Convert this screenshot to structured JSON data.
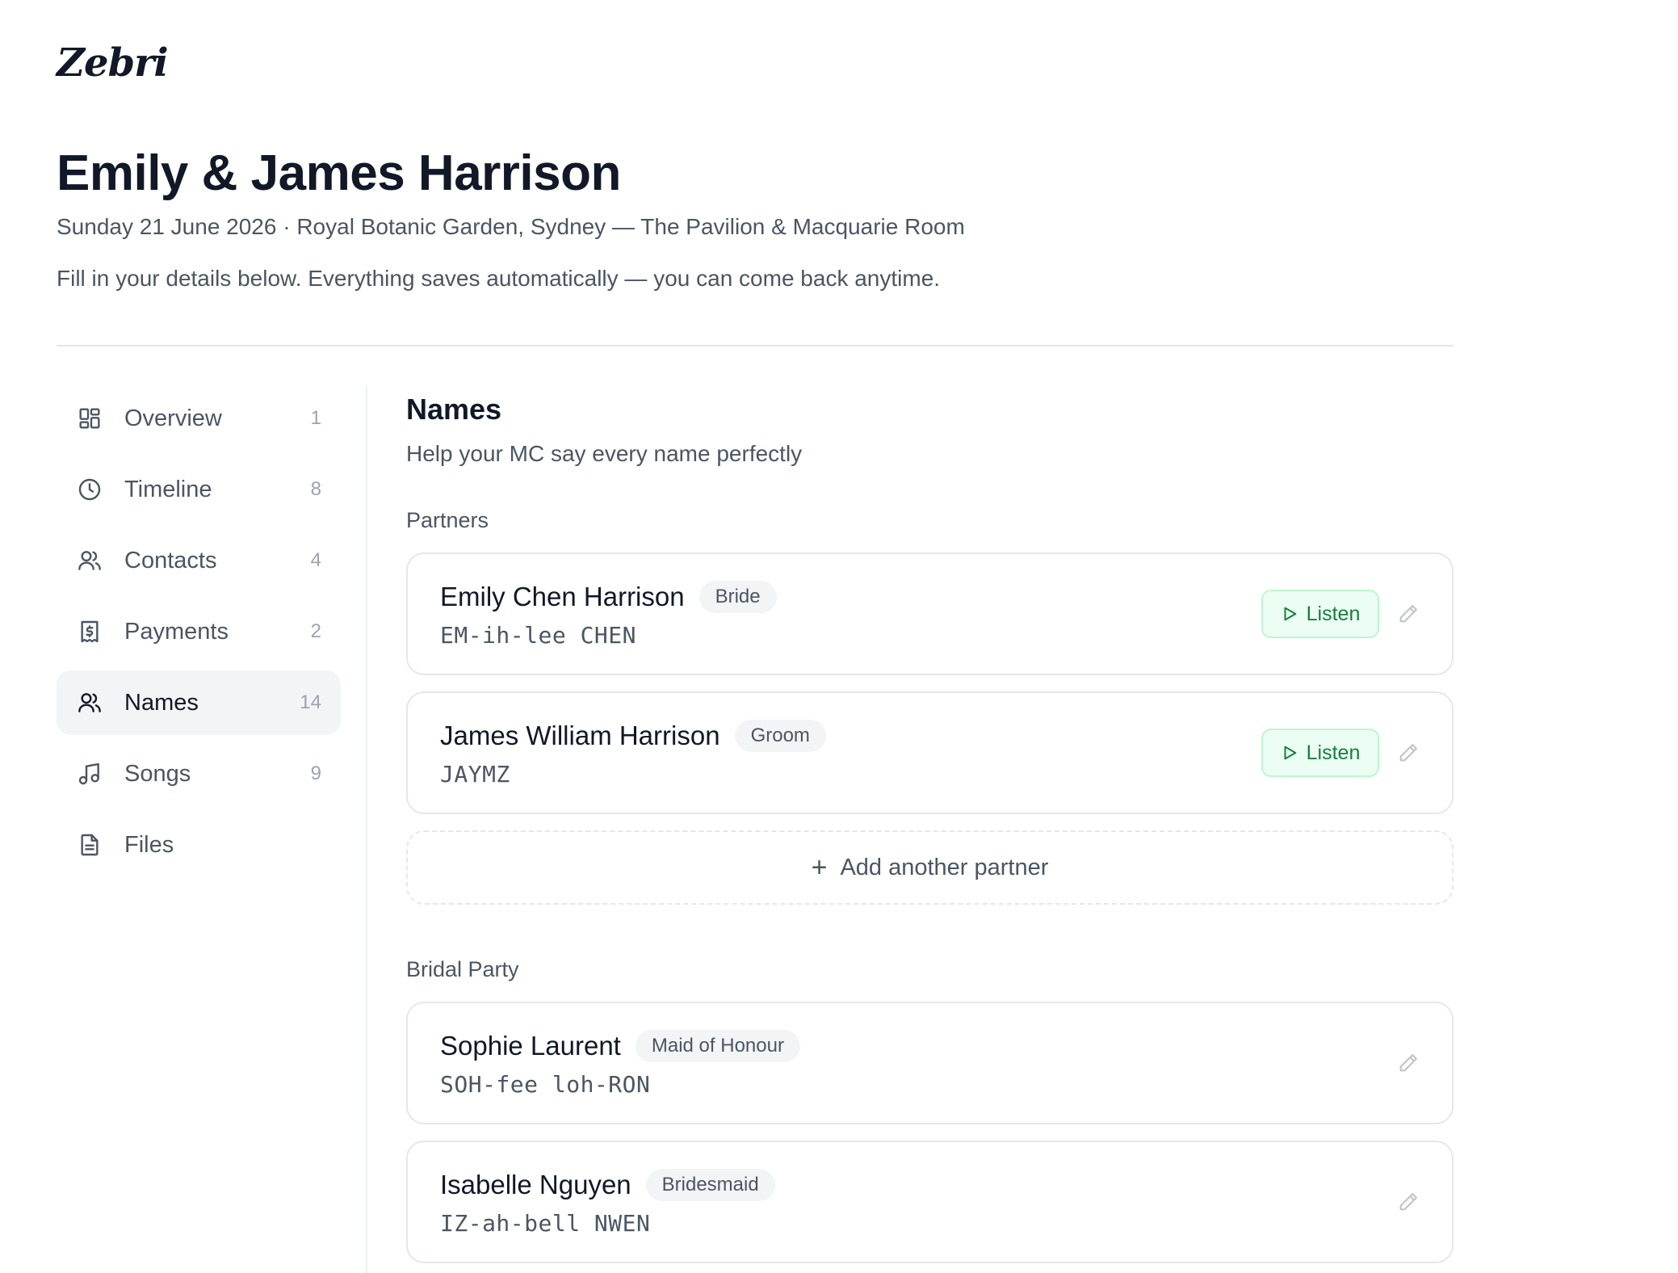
{
  "app": {
    "logo": "Zebri"
  },
  "header": {
    "title": "Emily & James Harrison",
    "subtitle": "Sunday 21 June 2026 · Royal Botanic Garden, Sydney — The Pavilion & Macquarie Room",
    "intro": "Fill in your details below. Everything saves automatically — you can come back anytime."
  },
  "sidebar": {
    "items": [
      {
        "label": "Overview",
        "count": "1",
        "icon": "grid-icon"
      },
      {
        "label": "Timeline",
        "count": "8",
        "icon": "clock-icon"
      },
      {
        "label": "Contacts",
        "count": "4",
        "icon": "users-icon"
      },
      {
        "label": "Payments",
        "count": "2",
        "icon": "receipt-icon"
      },
      {
        "label": "Names",
        "count": "14",
        "icon": "users-icon",
        "active": true
      },
      {
        "label": "Songs",
        "count": "9",
        "icon": "music-icon"
      },
      {
        "label": "Files",
        "count": "",
        "icon": "file-icon"
      }
    ]
  },
  "main": {
    "title": "Names",
    "subtitle": "Help your MC say every name perfectly",
    "partners": {
      "label": "Partners",
      "people": [
        {
          "name": "Emily Chen Harrison",
          "role": "Bride",
          "phonetic": "EM-ih-lee CHEN",
          "listen": "Listen"
        },
        {
          "name": "James William Harrison",
          "role": "Groom",
          "phonetic": "JAYMZ",
          "listen": "Listen"
        }
      ],
      "add_label": "Add another partner"
    },
    "bridal_party": {
      "label": "Bridal Party",
      "people": [
        {
          "name": "Sophie Laurent",
          "role": "Maid of Honour",
          "phonetic": "SOH-fee loh-RON"
        },
        {
          "name": "Isabelle Nguyen",
          "role": "Bridesmaid",
          "phonetic": "IZ-ah-bell NWEN"
        }
      ]
    }
  },
  "colors": {
    "accent_green": "#15803d",
    "listen_bg": "#ecfdf3",
    "text_primary": "#111827",
    "text_muted": "#4b5563"
  }
}
